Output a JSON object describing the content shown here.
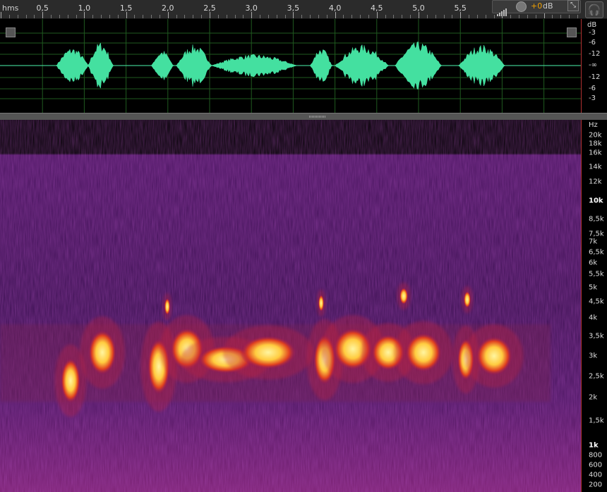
{
  "ruler": {
    "unit": "hms",
    "labels": [
      "0,5",
      "1,0",
      "1,5",
      "2,0",
      "2,5",
      "3,0",
      "3,5",
      "4,0",
      "4,5",
      "5,0",
      "5,5"
    ]
  },
  "meter": {
    "value": "+0",
    "unit": "dB"
  },
  "buttons": {
    "pin": "⤡",
    "headphones": "🎧"
  },
  "wave_scale": {
    "header": "dB",
    "labels": [
      "-3",
      "-6",
      "-12",
      "-∞",
      "-12",
      "-6",
      "-3"
    ]
  },
  "spec_scale": {
    "header": "Hz",
    "labels": [
      "20k",
      "18k",
      "16k",
      "14k",
      "12k",
      "10k",
      "8,5k",
      "7,5k",
      "7k",
      "6,5k",
      "6k",
      "5,5k",
      "5k",
      "4,5k",
      "4k",
      "3,5k",
      "3k",
      "2,5k",
      "2k",
      "1,5k",
      "1k",
      "800",
      "600",
      "400",
      "200"
    ]
  },
  "colors": {
    "waveform": "#44e0a0",
    "spectrogram_bg": "#3a1045",
    "spectrogram_hot": "#ffe070",
    "grid": "#1f5a1f",
    "scale_accent": "#b03030"
  }
}
